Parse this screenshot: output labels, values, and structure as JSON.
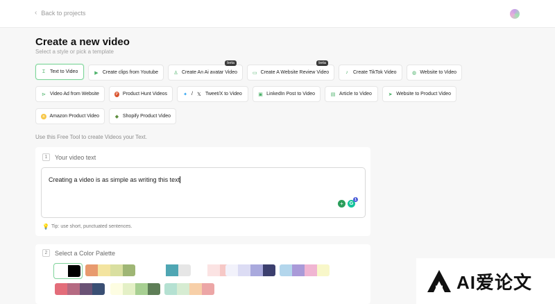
{
  "nav": {
    "back_label": "Back to projects"
  },
  "header": {
    "title": "Create a new video",
    "subtitle": "Select a style or pick a template"
  },
  "templates": [
    {
      "label": "Text to Video",
      "icon": "text-cursor-icon",
      "active": true
    },
    {
      "label": "Create clips from Youtube",
      "icon": "youtube-icon"
    },
    {
      "label": "Create An Ai avatar Video",
      "icon": "avatar-icon",
      "badge": "beta"
    },
    {
      "label": "Create A Website Review Video",
      "icon": "monitor-icon",
      "badge": "beta"
    },
    {
      "label": "Create TikTok Video",
      "icon": "tiktok-icon"
    },
    {
      "label": "Website to Video",
      "icon": "globe-icon"
    },
    {
      "label": "Video Ad from Website",
      "icon": "video-ad-icon"
    },
    {
      "label": "Product Hunt Videos",
      "icon": "product-hunt-icon"
    },
    {
      "label": "Tweet/X to Video",
      "icon": "twitter-x-icon",
      "separator": "/"
    },
    {
      "label": "LinkedIn Post to Video",
      "icon": "linkedin-icon"
    },
    {
      "label": "Article to Video",
      "icon": "article-icon"
    },
    {
      "label": "Website to Product Video",
      "icon": "cursor-icon"
    },
    {
      "label": "Amazon Product Video",
      "icon": "amazon-icon"
    },
    {
      "label": "Shopify Product Video",
      "icon": "shopify-icon"
    }
  ],
  "hint": "Use this Free Tool to create Videos your Text.",
  "step1": {
    "number": "1",
    "title": "Your video text",
    "value": "Creating a video is as simple as writing this text",
    "badge_count": "1",
    "tip": "Tip: use short, punctuated sentences."
  },
  "step2": {
    "number": "2",
    "title": "Select a Color Palette"
  },
  "palettes": [
    [
      "#ffffff",
      "#000000"
    ],
    [
      "#e89a6e",
      "#f3e4a0",
      "#d9dfa0",
      "#9fb675"
    ],
    [
      "#ffffff",
      "#ffffff",
      "#4fa6b3",
      "#e6e6e6"
    ],
    [
      "#ffffff",
      "#fbe3e3",
      "#f6c8c6",
      "#e9898a"
    ],
    [
      "#f2f2fb",
      "#dcdcf4",
      "#a9a9dd",
      "#3c3f6e"
    ],
    [
      "#b3d6ec",
      "#a99ad8",
      "#f0b5d2",
      "#f8f7c9"
    ],
    [
      "#e36d7a",
      "#b56a82",
      "#6a5275",
      "#3a4f74"
    ],
    [
      "#fdfde2",
      "#e4f0c6",
      "#a7cf92",
      "#5e7e57"
    ],
    [
      "#b5e1d2",
      "#d6ecd2",
      "#f7cfa8",
      "#eca6a6"
    ]
  ],
  "watermark": {
    "text": "AI爱论文"
  }
}
